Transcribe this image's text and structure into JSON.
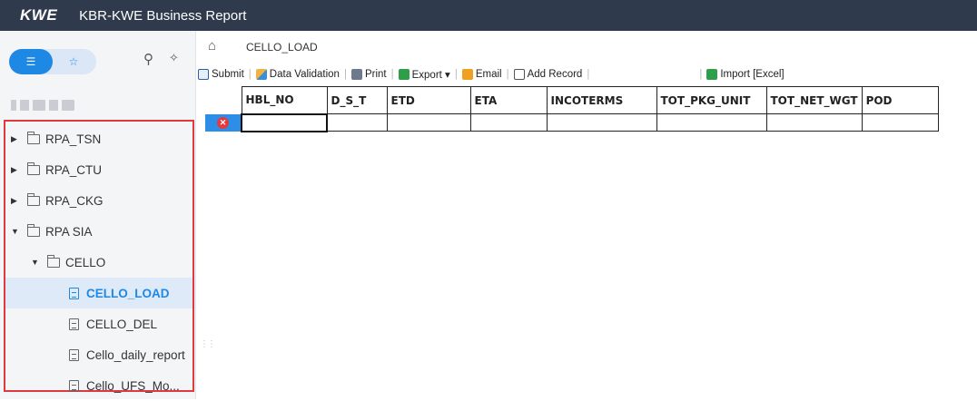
{
  "app": {
    "logo": "KWE",
    "title": "KBR-KWE Business Report"
  },
  "sidebar": {
    "tabs": [
      {
        "icon": "list-icon"
      },
      {
        "icon": "star-icon"
      }
    ],
    "tree": [
      {
        "label": "RPA_TSN",
        "type": "folder",
        "expanded": false,
        "level": 0
      },
      {
        "label": "RPA_CTU",
        "type": "folder",
        "expanded": false,
        "level": 0
      },
      {
        "label": "RPA_CKG",
        "type": "folder",
        "expanded": false,
        "level": 0
      },
      {
        "label": "RPA SIA",
        "type": "folder",
        "expanded": true,
        "level": 0
      },
      {
        "label": "CELLO",
        "type": "folder",
        "expanded": true,
        "level": 1
      },
      {
        "label": "CELLO_LOAD",
        "type": "report",
        "selected": true,
        "level": 2
      },
      {
        "label": "CELLO_DEL",
        "type": "report",
        "level": 2
      },
      {
        "label": "Cello_daily_report",
        "type": "report",
        "level": 2
      },
      {
        "label": "Cello_UFS_Mo...",
        "type": "report",
        "level": 2
      }
    ]
  },
  "tabs": {
    "active": "CELLO_LOAD"
  },
  "toolbar": {
    "submit": "Submit",
    "validation": "Data Validation",
    "print": "Print",
    "export": "Export ▾",
    "email": "Email",
    "add_record": "Add Record",
    "import": "Import [Excel]"
  },
  "grid": {
    "columns": [
      "HBL_NO",
      "D_S_T",
      "ETD",
      "ETA",
      "INCOTERMS",
      "TOT_PKG_UNIT",
      "TOT_NET_WGT",
      "POD"
    ],
    "rows": [
      [
        "",
        "",
        "",
        "",
        "",
        "",
        "",
        ""
      ]
    ]
  },
  "colors": {
    "topbar": "#2f3a4d",
    "accent": "#1e88e5",
    "highlight_border": "#e0393e",
    "delete": "#e5393c"
  }
}
